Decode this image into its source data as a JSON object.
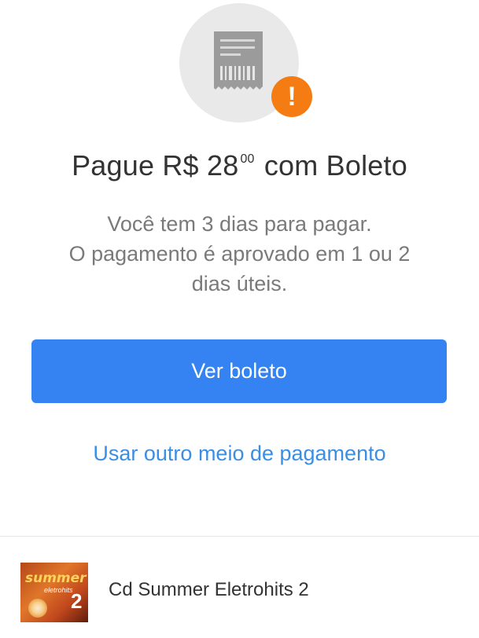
{
  "header": {
    "receipt_icon": "receipt-barcode-icon",
    "alert_icon": "exclamation-icon",
    "alert_symbol": "!"
  },
  "payment": {
    "title_prefix": "Pague R$ 28",
    "title_cents": "00",
    "title_suffix": "com Boleto",
    "desc_line1": "Você tem 3 dias para pagar.",
    "desc_line2": "O pagamento é aprovado em 1 ou 2",
    "desc_line3": "dias úteis."
  },
  "actions": {
    "primary_label": "Ver boleto",
    "secondary_label": "Usar outro meio de pagamento"
  },
  "item": {
    "thumb_word": "summer",
    "thumb_sub": "eletrohits",
    "thumb_number": "2",
    "name": "Cd Summer Eletrohits 2"
  },
  "colors": {
    "primary": "#3583f2",
    "link": "#3a8fe3",
    "alert": "#f57c13",
    "icon_bg": "#e9e9e9"
  }
}
